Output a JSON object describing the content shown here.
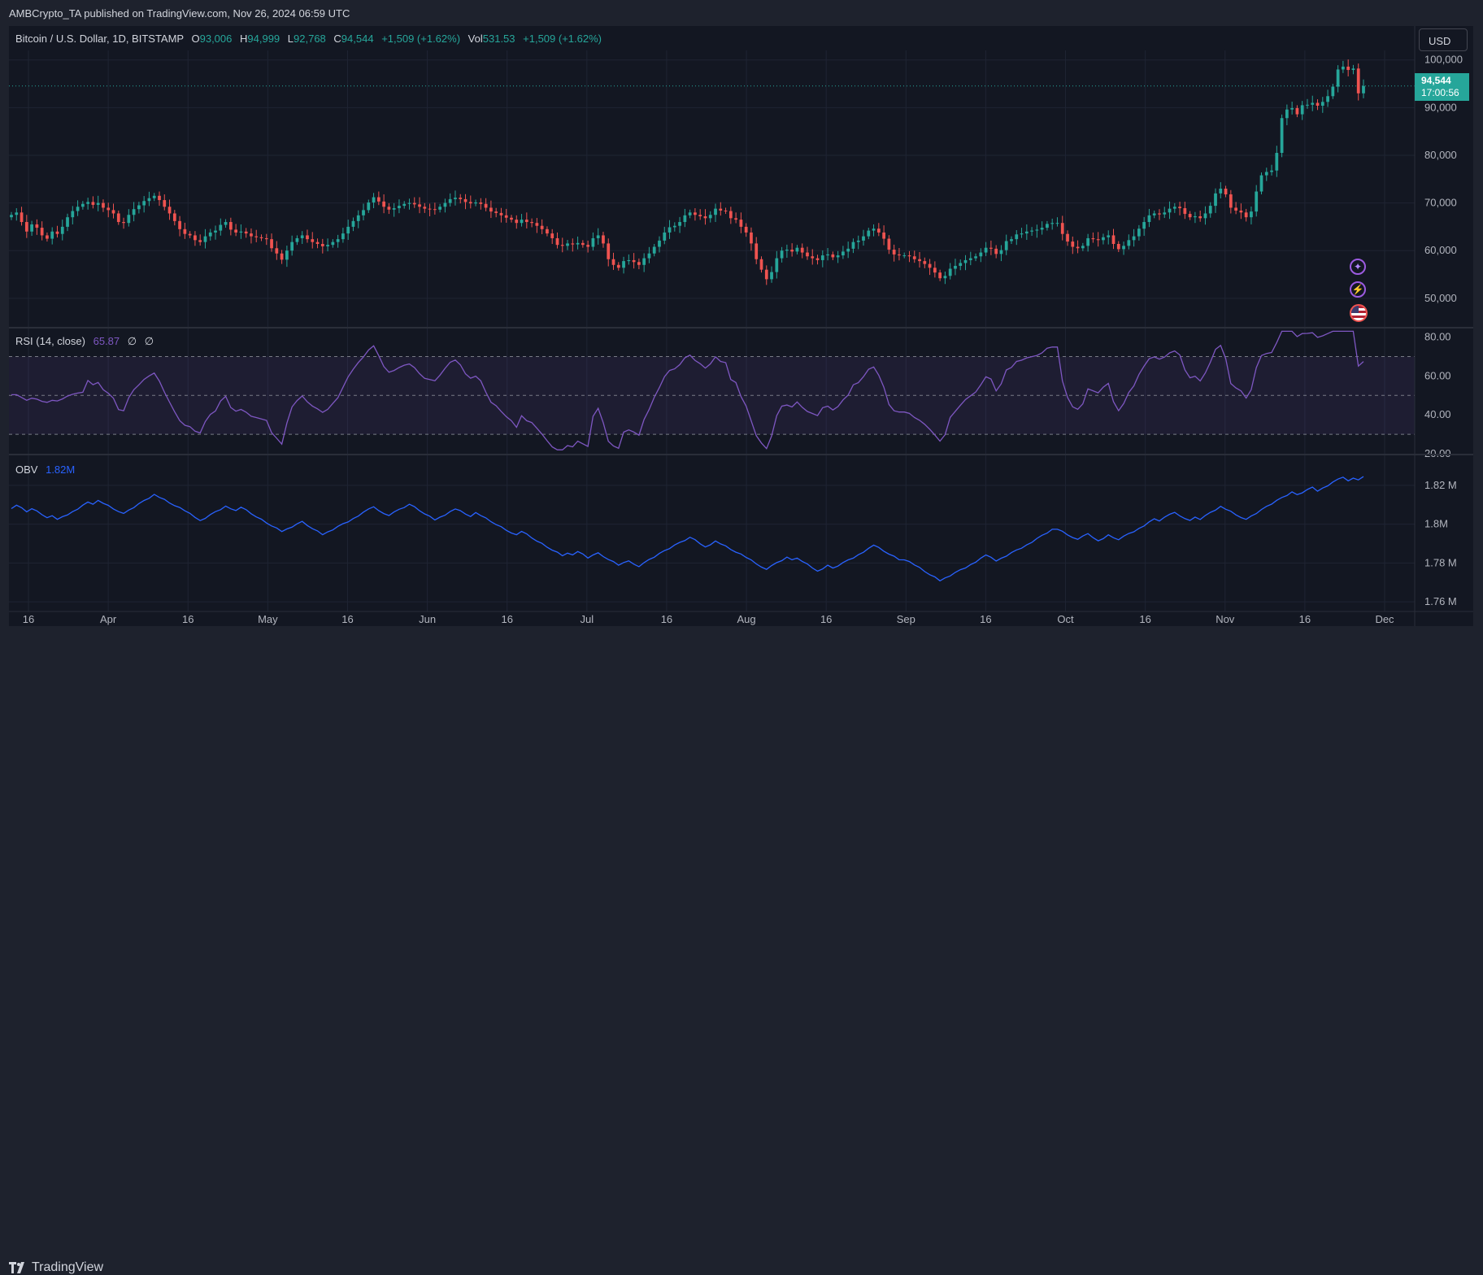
{
  "header": {
    "published": "AMBCrypto_TA published on TradingView.com, Nov 26, 2024 06:59 UTC"
  },
  "footer": {
    "brand": "TradingView"
  },
  "currency_button": "USD",
  "last_price": {
    "value": "94,544",
    "countdown": "17:00:56"
  },
  "legend": {
    "symbol": "Bitcoin / U.S. Dollar, 1D, BITSTAMP",
    "o_label": "O",
    "o": "93,006",
    "h_label": "H",
    "h": "94,999",
    "l_label": "L",
    "l": "92,768",
    "c_label": "C",
    "c": "94,544",
    "change": "+1,509 (+1.62%)",
    "vol_label": "Vol",
    "vol": "531.53",
    "vol_change": "+1,509 (+1.62%)"
  },
  "rsi": {
    "label": "RSI (14, close)",
    "value": "65.87",
    "extra1": "∅",
    "extra2": "∅"
  },
  "obv": {
    "label": "OBV",
    "value": "1.82M"
  },
  "colors": {
    "up": "#26a69a",
    "down": "#ef5350",
    "rsi": "#7e57c2",
    "obv": "#2962ff"
  },
  "chart_data": [
    {
      "type": "candlestick",
      "title": "Bitcoin / U.S. Dollar, 1D, BITSTAMP",
      "ylim": [
        44000,
        102000
      ],
      "yticks": [
        "50,000",
        "60,000",
        "70,000",
        "80,000",
        "90,000",
        "100,000"
      ],
      "x_tick_labels": [
        "16",
        "Apr",
        "16",
        "May",
        "16",
        "Jun",
        "16",
        "Jul",
        "16",
        "Aug",
        "16",
        "Sep",
        "16",
        "Oct",
        "16",
        "Nov",
        "16",
        "Dec"
      ],
      "close_series": [
        67500,
        68000,
        66000,
        64000,
        65500,
        64800,
        63200,
        62500,
        64000,
        63500,
        65000,
        67000,
        68300,
        69200,
        69800,
        70200,
        69600,
        70000,
        69000,
        68500,
        67800,
        66000,
        65800,
        67500,
        68700,
        69500,
        70400,
        71000,
        71500,
        70600,
        69200,
        67800,
        66200,
        64500,
        63500,
        63200,
        62200,
        61800,
        63000,
        63800,
        64200,
        65400,
        66000,
        64400,
        63800,
        64000,
        63600,
        63000,
        62800,
        62600,
        62400,
        60500,
        59400,
        58100,
        60000,
        61800,
        62600,
        63200,
        62400,
        61800,
        61400,
        60900,
        61200,
        61800,
        62400,
        63600,
        65000,
        66200,
        67400,
        68500,
        70100,
        71200,
        70300,
        69200,
        68600,
        68900,
        69400,
        69800,
        70000,
        69700,
        69200,
        68800,
        68700,
        68600,
        69200,
        70000,
        70800,
        71100,
        70800,
        70200,
        69900,
        70100,
        69800,
        69000,
        68200,
        67900,
        67400,
        66900,
        66500,
        65800,
        66500,
        66000,
        65800,
        65200,
        64500,
        63600,
        62600,
        61200,
        61000,
        61500,
        61300,
        61600,
        61200,
        60800,
        62600,
        63200,
        61500,
        58200,
        57000,
        56400,
        57800,
        58000,
        57600,
        57000,
        58400,
        59400,
        60800,
        62100,
        63800,
        64900,
        65200,
        66000,
        67400,
        68000,
        67500,
        67200,
        66800,
        67500,
        68800,
        68400,
        68300,
        66800,
        66500,
        65000,
        63800,
        61500,
        58200,
        56000,
        54000,
        55500,
        58400,
        60000,
        60200,
        59800,
        60600,
        59600,
        58800,
        58400,
        58000,
        59000,
        59200,
        58600,
        59000,
        59800,
        60400,
        61800,
        62100,
        63000,
        64200,
        64600,
        63800,
        62500,
        60200,
        59200,
        59000,
        59000,
        58800,
        58200,
        57800,
        57200,
        56400,
        55400,
        54200,
        54700,
        56200,
        56800,
        57400,
        58000,
        58400,
        58800,
        59600,
        60600,
        60400,
        59300,
        60100,
        62000,
        62400,
        63400,
        63600,
        64000,
        64200,
        64400,
        64800,
        65600,
        65800,
        65800,
        63500,
        61900,
        60800,
        60500,
        61000,
        62600,
        62400,
        62200,
        62800,
        63200,
        61400,
        60300,
        61000,
        62200,
        63000,
        64600,
        66000,
        67400,
        67800,
        67600,
        68000,
        68800,
        69200,
        68900,
        67700,
        67000,
        67200,
        66800,
        67800,
        69400,
        72000,
        73000,
        71800,
        69000,
        68400,
        68000,
        67000,
        68200,
        72400,
        75800,
        76500,
        76800,
        80500,
        87800,
        89600,
        89900,
        88600,
        90500,
        90600,
        91000,
        90400,
        91200,
        92400,
        94400,
        98000,
        98600,
        97900,
        98200,
        93000,
        94544
      ]
    },
    {
      "type": "line",
      "title": "RSI (14, close)",
      "ylim": [
        20,
        84
      ],
      "yticks": [
        "20.00",
        "40.00",
        "60.00",
        "80.00"
      ],
      "bands": [
        30,
        50,
        70
      ],
      "x_tick_labels": [
        "16",
        "Apr",
        "16",
        "May",
        "16",
        "Jun",
        "16",
        "Jul",
        "16",
        "Aug",
        "16",
        "Sep",
        "16",
        "Oct",
        "16",
        "Nov",
        "16",
        "Dec"
      ]
    },
    {
      "type": "line",
      "title": "OBV",
      "ylim": [
        1.755,
        1.835
      ],
      "yticks": [
        "1.76 M",
        "1.78 M",
        "1.8M",
        "1.82 M"
      ],
      "x_tick_labels": [
        "16",
        "Apr",
        "16",
        "May",
        "16",
        "Jun",
        "16",
        "Jul",
        "16",
        "Aug",
        "16",
        "Sep",
        "16",
        "Oct",
        "16",
        "Nov",
        "16",
        "Dec"
      ]
    }
  ]
}
